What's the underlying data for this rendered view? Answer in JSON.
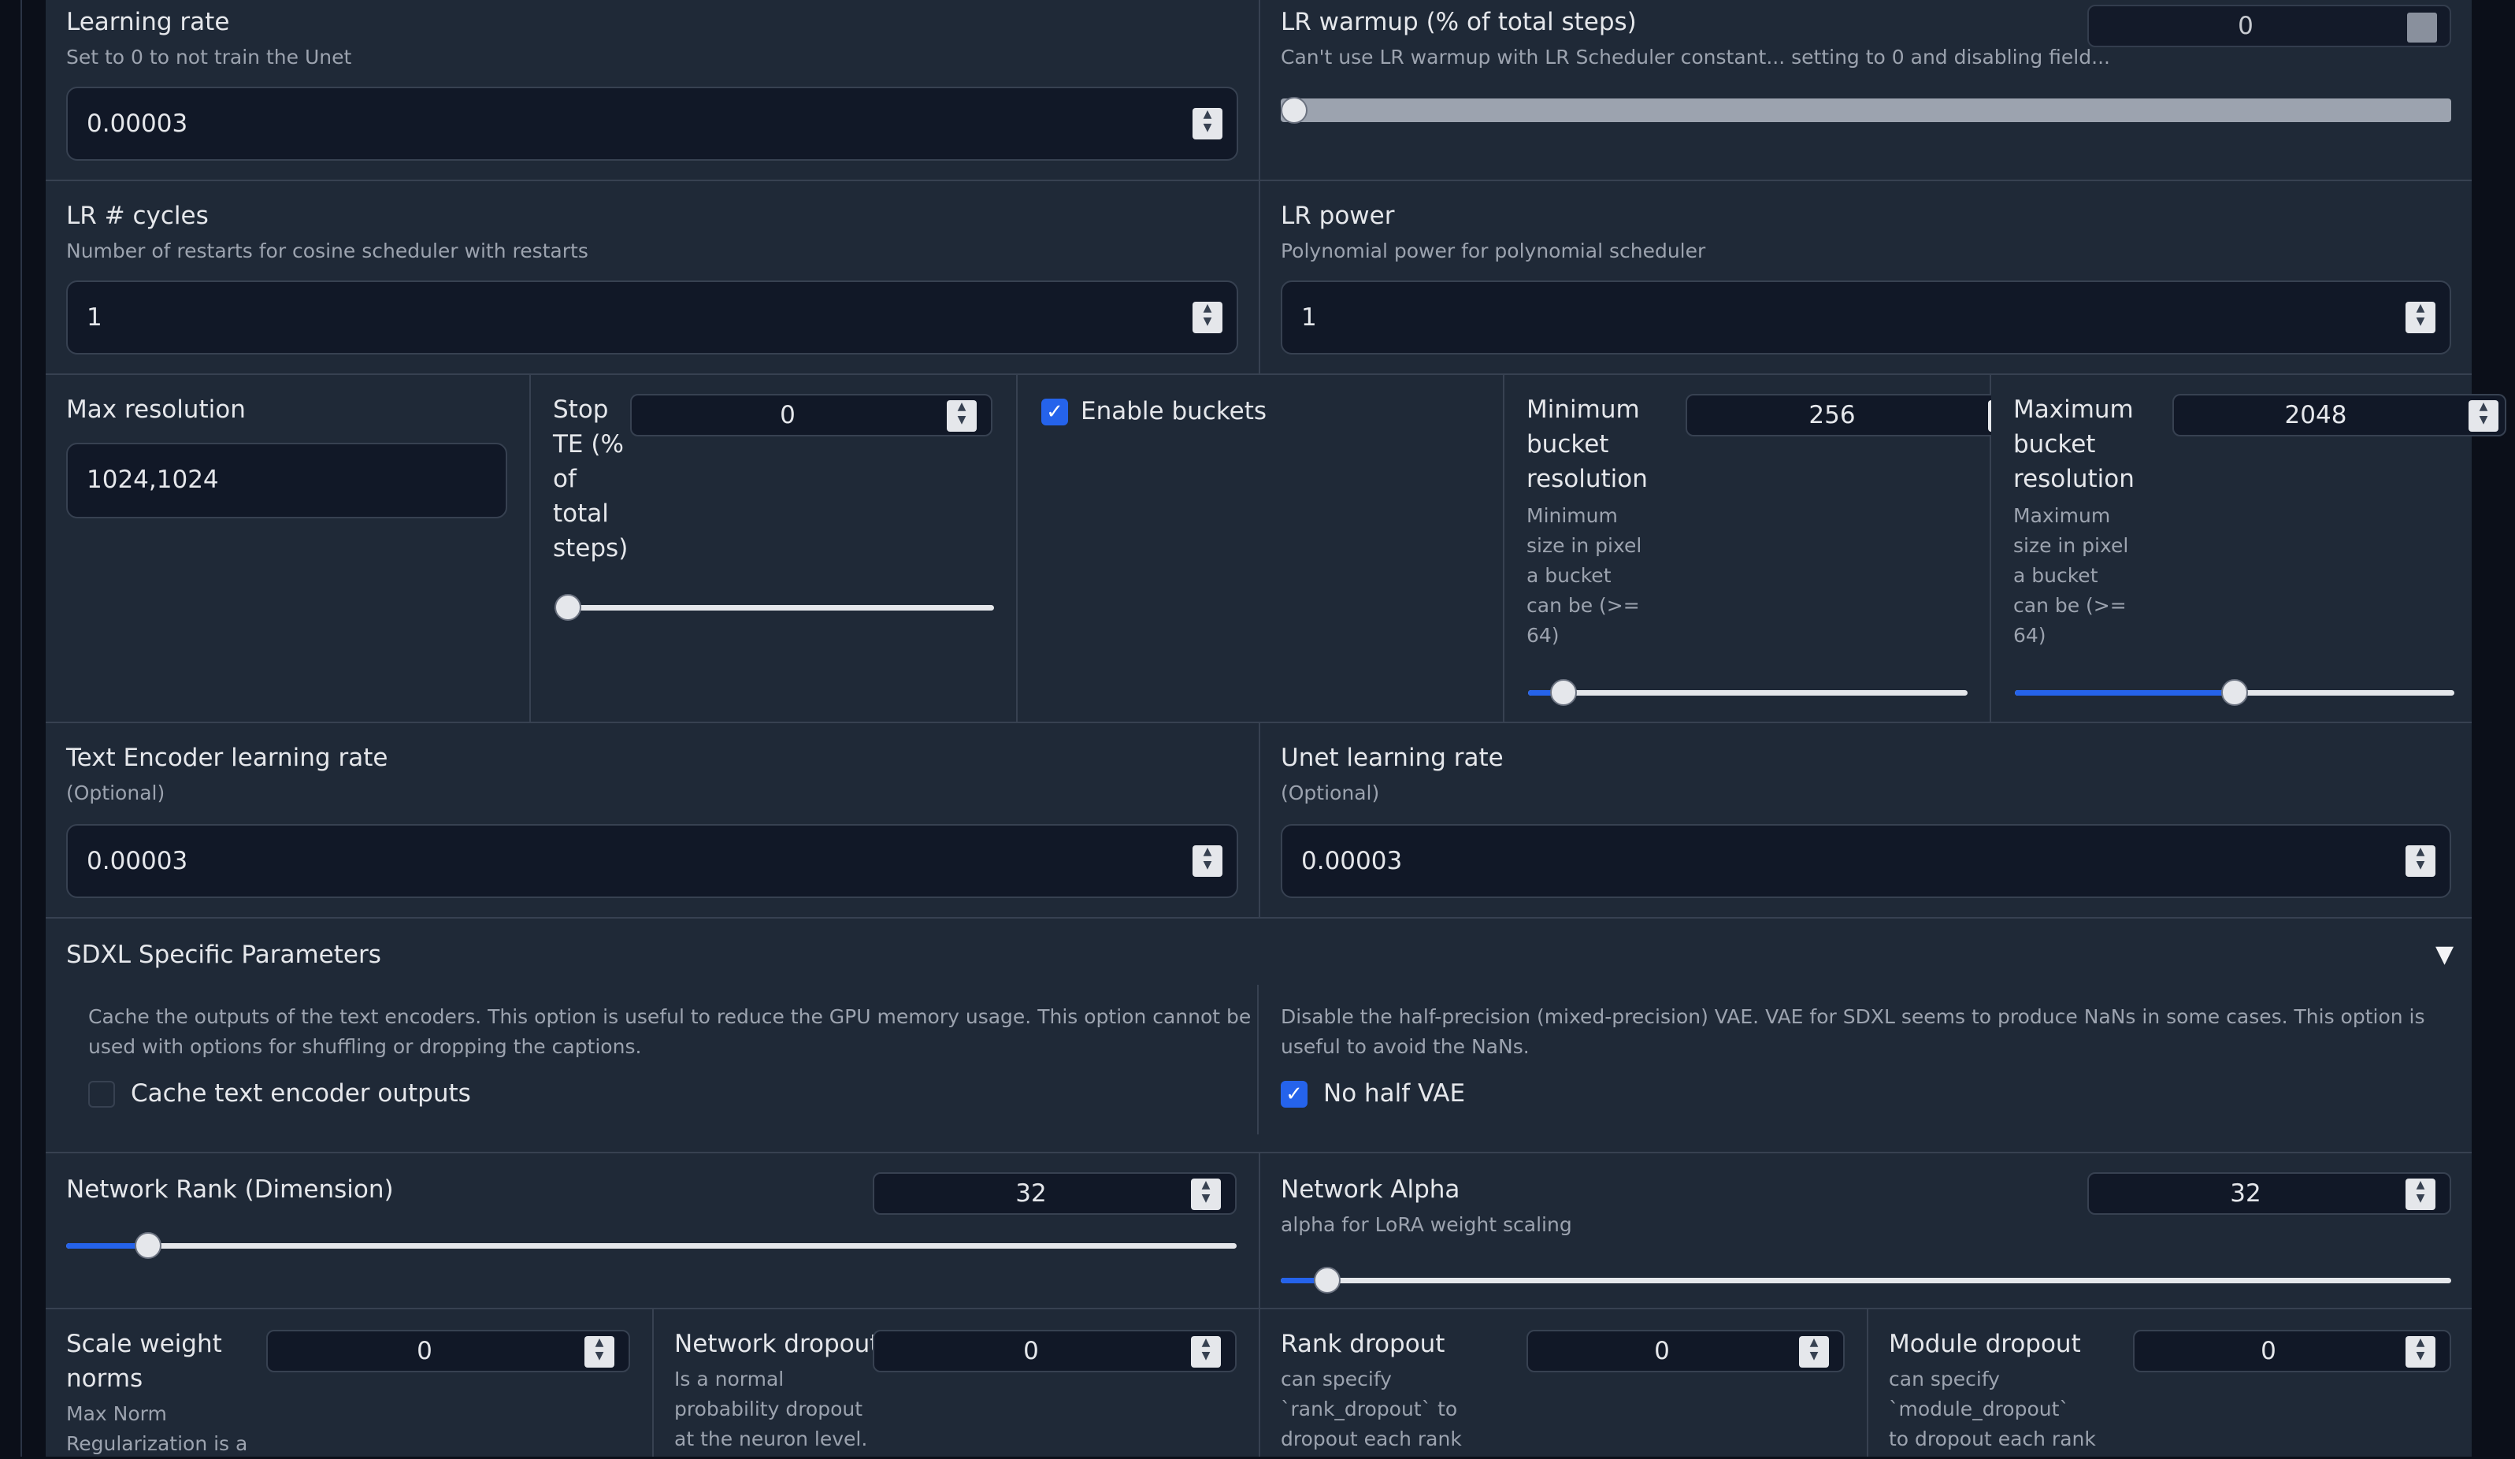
{
  "row1": {
    "learning_rate": {
      "label": "Learning rate",
      "info": "Set to 0 to not train the Unet",
      "value": "0.00003"
    },
    "lr_warmup": {
      "label": "LR warmup (% of total steps)",
      "info": "Can't use LR warmup with LR Scheduler constant... setting to 0 and disabling field...",
      "value": "0",
      "slider_value": 0
    }
  },
  "row2": {
    "lr_cycles": {
      "label": "LR # cycles",
      "info": "Number of restarts for cosine scheduler with restarts",
      "value": "1"
    },
    "lr_power": {
      "label": "LR power",
      "info": "Polynomial power for polynomial scheduler",
      "value": "1"
    }
  },
  "row3": {
    "max_resolution": {
      "label": "Max resolution",
      "value": "1024,1024"
    },
    "stop_te": {
      "label_lines": [
        "Stop",
        "TE (%",
        "of",
        "total",
        "steps)"
      ],
      "value": "0",
      "slider_value": 0
    },
    "enable_buckets": {
      "label": "Enable buckets",
      "checked": true
    },
    "min_bucket": {
      "label_lines": [
        "Minimum",
        "bucket",
        "resolution"
      ],
      "info_lines": [
        "Minimum",
        "size in pixel",
        "a bucket",
        "can be (>=",
        "64)"
      ],
      "value": "256",
      "slider_fraction": 0.08
    },
    "max_bucket": {
      "label_lines": [
        "Maximum",
        "bucket",
        "resolution"
      ],
      "info_lines": [
        "Maximum",
        "size in pixel",
        "a bucket",
        "can be (>=",
        "64)"
      ],
      "value": "2048",
      "slider_fraction": 0.5
    }
  },
  "row4": {
    "te_lr": {
      "label": "Text Encoder learning rate",
      "info": "(Optional)",
      "value": "0.00003"
    },
    "unet_lr": {
      "label": "Unet learning rate",
      "info": "(Optional)",
      "value": "0.00003"
    }
  },
  "sdxl": {
    "title": "SDXL Specific Parameters",
    "toggle_icon": "▼",
    "cache_te": {
      "info_line1": "Cache the outputs of the text encoders. This option is useful to reduce the GPU memory usage. This option cannot be",
      "info_line2": "used with options for shuffling or dropping the captions.",
      "label": "Cache text encoder outputs",
      "checked": false
    },
    "no_half_vae": {
      "info_line1": "Disable the half-precision (mixed-precision) VAE. VAE for SDXL seems to produce NaNs in some cases. This option is",
      "info_line2": "useful to avoid the NaNs.",
      "label": "No half VAE",
      "checked": true
    }
  },
  "row6": {
    "network_rank": {
      "label": "Network Rank (Dimension)",
      "value": "32",
      "slider_fraction": 0.07
    },
    "network_alpha": {
      "label": "Network Alpha",
      "info": "alpha for LoRA weight scaling",
      "value": "32",
      "slider_fraction": 0.04
    }
  },
  "row7": {
    "scale_weight_norms": {
      "label_lines": [
        "Scale weight",
        "norms"
      ],
      "info_lines": [
        "Max Norm",
        "Regularization is a"
      ],
      "value": "0"
    },
    "network_dropout": {
      "label": "Network dropout",
      "info_lines": [
        "Is a normal",
        "probability dropout",
        "at the neuron level."
      ],
      "value": "0"
    },
    "rank_dropout": {
      "label": "Rank dropout",
      "info_lines": [
        "can specify",
        "`rank_dropout` to",
        "dropout each rank"
      ],
      "value": "0"
    },
    "module_dropout": {
      "label": "Module dropout",
      "info_lines": [
        "can specify",
        "`module_dropout`",
        "to dropout each rank"
      ],
      "value": "0"
    }
  },
  "colors": {
    "accent": "#2563eb",
    "panel": "#1f2937",
    "input_bg": "#111827",
    "border": "#374151"
  }
}
